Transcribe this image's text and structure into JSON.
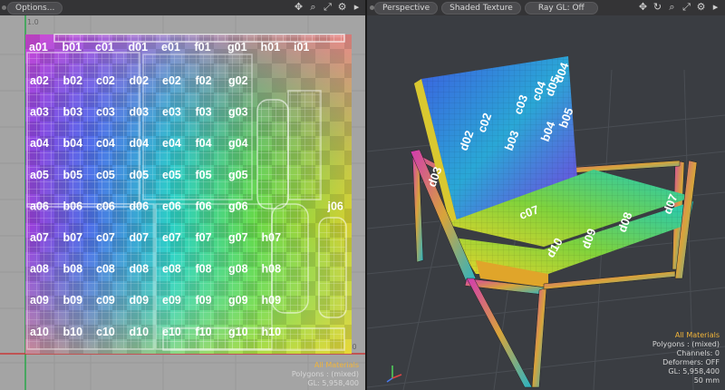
{
  "uv_view": {
    "options_label": "Options...",
    "tick_top": "1.0",
    "tick_bottom": ".0",
    "info_materials": "All Materials",
    "info_polygons": "Polygons : (mixed)",
    "info_gl": "GL: 5,958,400",
    "labels_row1": [
      "a01",
      "b01",
      "c01",
      "d01",
      "e01",
      "f01",
      "g01",
      "h01",
      "i01"
    ],
    "labels": [
      [
        "a02",
        "b02",
        "c02",
        "d02",
        "e02",
        "f02",
        "g02"
      ],
      [
        "a03",
        "b03",
        "c03",
        "d03",
        "e03",
        "f03",
        "g03"
      ],
      [
        "a04",
        "b04",
        "c04",
        "d04",
        "e04",
        "f04",
        "g04"
      ],
      [
        "a05",
        "b05",
        "c05",
        "d05",
        "e05",
        "f05",
        "g05"
      ],
      [
        "a06",
        "b06",
        "c06",
        "d06",
        "e06",
        "f06",
        "g06",
        "",
        "",
        "j06"
      ],
      [
        "a07",
        "b07",
        "c07",
        "d07",
        "e07",
        "f07",
        "g07",
        "h07"
      ],
      [
        "a08",
        "b08",
        "c08",
        "d08",
        "e08",
        "f08",
        "g08",
        "h08"
      ],
      [
        "a09",
        "b09",
        "c09",
        "d09",
        "e09",
        "f09",
        "g09",
        "h09"
      ],
      [
        "a10",
        "b10",
        "c10",
        "d10",
        "e10",
        "f10",
        "g10",
        "h10"
      ]
    ]
  },
  "persp_view": {
    "tab_perspective": "Perspective",
    "tab_shading": "Shaded Texture",
    "tab_raygl": "Ray GL: Off",
    "info_materials": "All Materials",
    "info_polygons": "Polygons : (mixed)",
    "info_channels": "Channels: 0",
    "info_deformers": "Deformers: OFF",
    "info_gl": "GL: 5,958,400",
    "info_scale": "50 mm",
    "chair_labels_back": [
      "d02",
      "c02",
      "c03",
      "c04",
      "b03",
      "b04",
      "b05",
      "d03"
    ],
    "chair_labels_seat": [
      "d07",
      "d08",
      "d09",
      "d10",
      "c07"
    ],
    "chair_labels_top": [
      "d04",
      "d05"
    ]
  },
  "icons": [
    "move-icon",
    "zoom-icon",
    "fit-icon",
    "settings-icon",
    "expand-icon",
    "rotate-icon"
  ]
}
